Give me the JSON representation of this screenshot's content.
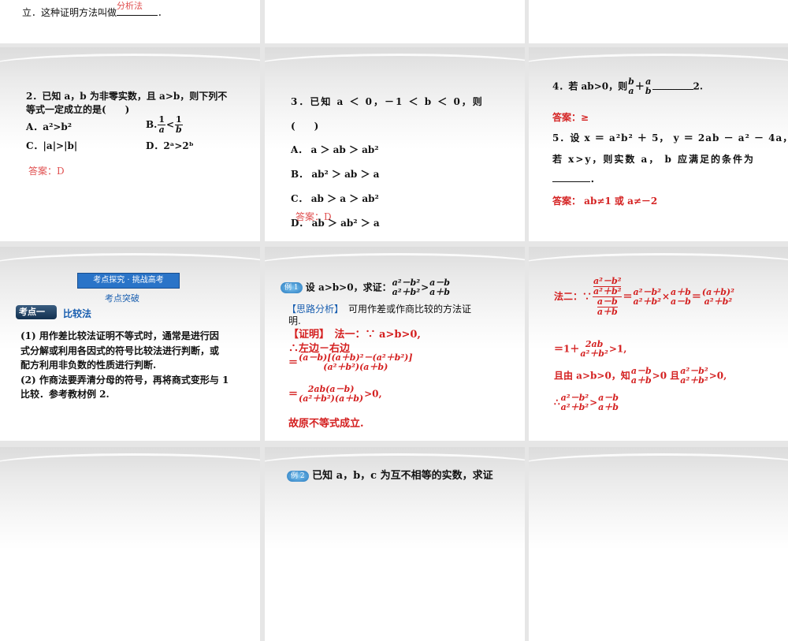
{
  "s0": {
    "text": "立．这种证明方法叫做",
    "answer": "分析法",
    "end": "．"
  },
  "s1": {
    "q1": "2．已知 a，b 为非零实数，且 a>b，则下列不",
    "q2": "等式一定成立的是(　　)",
    "A": "A．a²>b²",
    "B_label": "B.",
    "B_n": "1",
    "B_d1": "a",
    "B_lt": "<",
    "B_d2": "b",
    "C": "C．|a|>|b|",
    "D": "D．2ᵃ>2ᵇ",
    "answer": "答案：D"
  },
  "s2": {
    "q": "3．已知 a ＜ 0，－1 ＜ b ＜ 0，则",
    "paren": "(　　)",
    "A": "A． a ＞ ab ＞ ab²",
    "B": "B． ab² ＞ ab ＞ a",
    "C": "C． ab ＞ a ＞ ab²",
    "D": "D． ab ＞ ab² ＞ a",
    "answer": "答案：D"
  },
  "s3": {
    "q4a": "4．若 ab>0，则",
    "q4b": "2.",
    "frac1n": "b",
    "frac1d": "a",
    "plus": "＋",
    "frac2n": "a",
    "frac2d": "b",
    "ans4": "答案：≥",
    "q5a": "5．设 x ＝ a²b² ＋ 5， y ＝ 2ab － a² － 4a，",
    "q5b": "若 x>y，则实数 a， b 应满足的条件为",
    "q5c": "．",
    "ans5": "答案： ab≠1 或 a≠－2"
  },
  "s4": {
    "banner": "考点探究 · 挑战高考",
    "subtitle": "考点突破",
    "tag": "考点一",
    "topic": "比较法",
    "p1": "(1) 用作差比较法证明不等式时，通常是进行因",
    "p2": "式分解或利用各因式的符号比较法进行判断，或",
    "p3": "配方利用非负数的性质进行判断.",
    "p4": "(2) 作商法要弄清分母的符号，再将商式变形与 1",
    "p5": "比较．参考教材例 2."
  },
  "s5": {
    "badge": "例 1",
    "q": "设 a>b>0，求证：",
    "fA": "a²－b²",
    "fB": "a²＋b²",
    "gt": ">",
    "fC": "a－b",
    "fD": "a＋b",
    "hint_label": "【思路分析】",
    "hint": "可用作差或作商比较的方法证",
    "hint2": "明.",
    "proof_label": "【证明】",
    "l1": "法一：∵ a>b>0,",
    "l2": "∴左边－右边",
    "l3n": "(a－b)[(a＋b)²－(a²＋b²)]",
    "l3d": "(a²＋b²)(a＋b)",
    "l4n": "2ab(a－b)",
    "l4d": "(a²＋b²)(a＋b)",
    "l4e": ">0,",
    "eq": "＝",
    "l5": "故原不等式成立."
  },
  "s6": {
    "l1": "法二：∵",
    "n1": "a²－b²",
    "d1": "a²＋b²",
    "n2": "a－b",
    "d2": "a＋b",
    "times": "×",
    "r1n": "(a＋b)²",
    "r1d": "a²＋b²",
    "l2a": "＝1＋",
    "l2n": "2ab",
    "l2d": "a²＋b²",
    "l2e": ">1,",
    "l3a": "且由 a>b>0，知",
    "l3b": ">0 且",
    "l3c": ">0,",
    "l4": "∴",
    "gt": ">",
    "eq": "＝"
  },
  "s7": {
    "badge": "例 2",
    "text": "已知 a，b，c 为互不相等的实数，求证"
  }
}
